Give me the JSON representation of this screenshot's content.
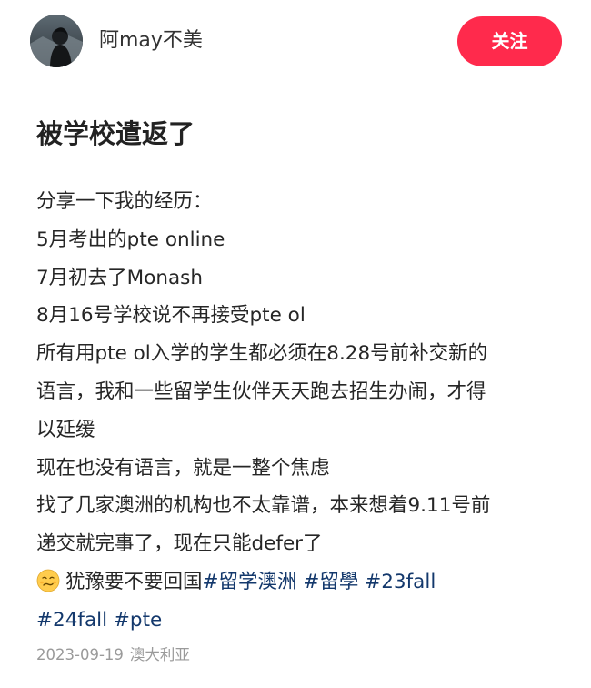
{
  "header": {
    "author_name": "阿may不美",
    "follow_label": "关注",
    "avatar_icon": "user-avatar",
    "follow_color": "#ff2a4c"
  },
  "post": {
    "title": "被学校遣返了",
    "lines": [
      "分享一下我的经历：",
      "5月考出的pte online",
      "7月初去了Monash",
      "8月16号学校说不再接受pte ol",
      "所有用pte ol入学的学生都必须在8.28号前补交新的",
      "语言，我和一些留学生伙伴天天跑去招生办闹，才得",
      "以延缓",
      "现在也没有语言，就是一整个焦虑",
      "找了几家澳洲的机构也不太靠谱，本来想着9.11号前",
      "递交就完事了，现在只能defer了"
    ],
    "last_line_text": "犹豫要不要回国",
    "emoji_icon": "worried-face-emoji",
    "tags": [
      "#留学澳洲",
      "#留學",
      "#23fall",
      "#24fall",
      "#pte"
    ],
    "tag_color": "#13386c"
  },
  "footer": {
    "date": "2023-09-19",
    "location": "澳大利亚"
  }
}
